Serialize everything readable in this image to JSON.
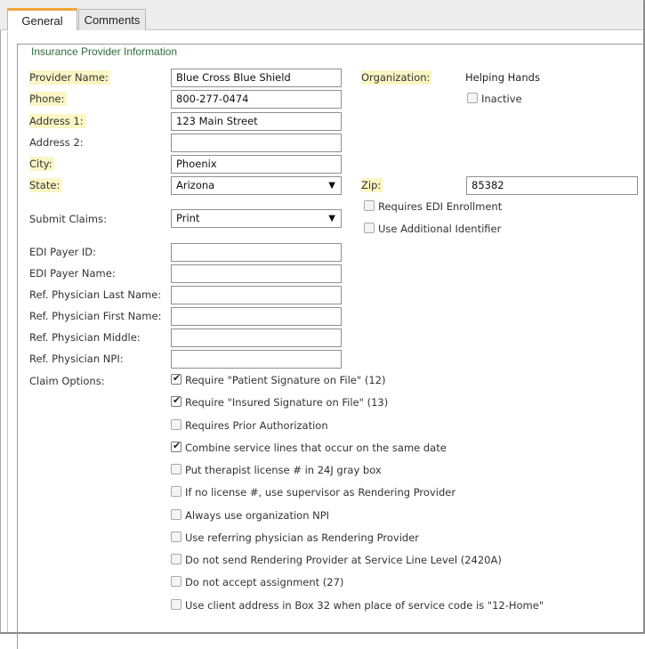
{
  "tabs": [
    {
      "label": "General"
    },
    {
      "label": "Comments"
    }
  ],
  "section": {
    "legend": "Insurance Provider Information"
  },
  "fields": {
    "provider_name": {
      "label": "Provider Name:",
      "value": "Blue Cross Blue Shield"
    },
    "phone": {
      "label": "Phone:",
      "value": "800-277-0474"
    },
    "address1": {
      "label": "Address 1:",
      "value": "123 Main Street"
    },
    "address2": {
      "label": "Address 2:",
      "value": ""
    },
    "city": {
      "label": "City:",
      "value": "Phoenix"
    },
    "state": {
      "label": "State:",
      "value": "Arizona"
    },
    "zip": {
      "label": "Zip:",
      "value": "85382"
    },
    "organization": {
      "label": "Organization:",
      "value": "Helping Hands"
    },
    "submit_claims": {
      "label": "Submit Claims:",
      "value": "Print"
    },
    "edi_payer_id": {
      "label": "EDI Payer ID:",
      "value": ""
    },
    "edi_payer_name": {
      "label": "EDI Payer Name:",
      "value": ""
    },
    "ref_last": {
      "label": "Ref. Physician Last Name:",
      "value": ""
    },
    "ref_first": {
      "label": "Ref. Physician First Name:",
      "value": ""
    },
    "ref_middle": {
      "label": "Ref. Physician Middle:",
      "value": ""
    },
    "ref_npi": {
      "label": "Ref. Physician NPI:",
      "value": ""
    },
    "claim_options": {
      "label": "Claim Options:"
    }
  },
  "side_options": {
    "inactive": {
      "label": "Inactive",
      "checked": false
    },
    "requires_edi": {
      "label": "Requires EDI Enrollment",
      "checked": false
    },
    "additional_identifier": {
      "label": "Use Additional Identifier",
      "checked": false
    }
  },
  "claim_options": [
    {
      "label": "Require \"Patient Signature on File\" (12)",
      "checked": true
    },
    {
      "label": "Require \"Insured Signature on File\" (13)",
      "checked": true
    },
    {
      "label": "Requires Prior Authorization",
      "checked": false
    },
    {
      "label": "Combine service lines that occur on the same date",
      "checked": true
    },
    {
      "label": "Put therapist license # in 24J gray box",
      "checked": false
    },
    {
      "label": "If no license #, use supervisor as Rendering Provider",
      "checked": false
    },
    {
      "label": "Always use organization NPI",
      "checked": false
    },
    {
      "label": "Use referring physician as Rendering Provider",
      "checked": false
    },
    {
      "label": "Do not send Rendering Provider at Service Line Level (2420A)",
      "checked": false
    },
    {
      "label": "Do not accept assignment (27)",
      "checked": false
    },
    {
      "label": "Use client address in Box 32 when place of service code is \"12-Home\"",
      "checked": false
    }
  ],
  "icons": {
    "dropdown": "triangle-down-icon",
    "check": "checkmark-icon"
  },
  "colors": {
    "required_highlight": "#fbf6c4",
    "active_tab_accent": "#f0a63a",
    "legend_text": "#2f6b3b"
  }
}
